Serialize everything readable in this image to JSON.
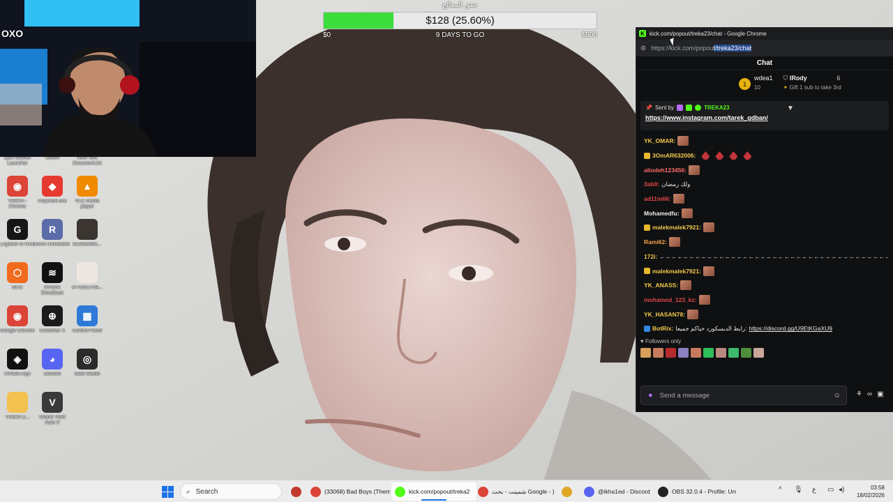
{
  "goal": {
    "title": "حقق المعالج",
    "amount_label": "$128 (25.60%)",
    "progress": 0.256,
    "min_label": "$0",
    "max_label": "$500",
    "days_label": "9 DAYS TO GO",
    "fill_color": "#3ddc3d"
  },
  "webcam": {
    "overlay_text": "OXO"
  },
  "desktop_icons": [
    {
      "label": "Epic Games Launcher",
      "icon": "epic-games-icon",
      "color": "#2b2b2b",
      "glyph": "E"
    },
    {
      "label": "Steam",
      "icon": "steam-icon",
      "color": "#1b2838",
      "glyph": "S"
    },
    {
      "label": "New Text Document.txt",
      "icon": "text-document-icon",
      "color": "#f2f2f2",
      "glyph": ""
    },
    {
      "label": "TREKA - Chrome",
      "icon": "chrome-icon",
      "color": "#db4437",
      "glyph": "◉"
    },
    {
      "label": "AnyDesk.exe",
      "icon": "anydesk-icon",
      "color": "#e63a31",
      "glyph": "◆"
    },
    {
      "label": "VLC media player",
      "icon": "vlc-icon",
      "color": "#f08a00",
      "glyph": "▲"
    },
    {
      "label": "Logitech G HUB",
      "icon": "logitech-ghub-icon",
      "color": "#161616",
      "glyph": "G"
    },
    {
      "label": "Revo Uninstaller",
      "icon": "revo-uninstaller-icon",
      "color": "#5b6ca8",
      "glyph": "R"
    },
    {
      "label": "b14f2eff6fe...",
      "icon": "image-file-icon",
      "color": "#3a3530",
      "glyph": ""
    },
    {
      "label": "GCC",
      "icon": "gcc-icon",
      "color": "#f06b1d",
      "glyph": "⬡"
    },
    {
      "label": "NVIDIA Broadcast",
      "icon": "nvidia-broadcast-icon",
      "color": "#111",
      "glyph": "≋"
    },
    {
      "label": "477a3c17d4...",
      "icon": "image-file-icon",
      "color": "#ede6e0",
      "glyph": ""
    },
    {
      "label": "Google Chrome",
      "icon": "chrome-icon",
      "color": "#db4437",
      "glyph": "◉"
    },
    {
      "label": "Crosshair X",
      "icon": "crosshair-icon",
      "color": "#1b1b1b",
      "glyph": "⊕"
    },
    {
      "label": "Control Panel",
      "icon": "control-panel-icon",
      "color": "#2f7ad6",
      "glyph": "▦"
    },
    {
      "label": "NVIDIA App",
      "icon": "nvidia-app-icon",
      "color": "#111",
      "glyph": "◈"
    },
    {
      "label": "Discord",
      "icon": "discord-icon",
      "color": "#5865f2",
      "glyph": "◕"
    },
    {
      "label": "OBS Studio",
      "icon": "obs-icon",
      "color": "#2b2b2b",
      "glyph": "◎"
    },
    {
      "label": "TREKA Z...",
      "icon": "folder-icon",
      "color": "#f2c14e",
      "glyph": ""
    },
    {
      "label": "Grand Theft Auto V",
      "icon": "gta-icon",
      "color": "#3a3a3a",
      "glyph": "V"
    }
  ],
  "chrome": {
    "title": "kick.com/popout/treka23/chat - Google Chrome",
    "url_prefix": "https://kick.com/popou",
    "url_selected": "t/treka23/chat"
  },
  "chat": {
    "header": "Chat",
    "leaderboard": {
      "rank": "1",
      "first_name": "wdea1",
      "first_count": "10",
      "second_name": "IRody",
      "second_count": "6",
      "gift_text": "Gift 1 sub to take 3rd"
    },
    "pinned": {
      "sent_by_label": "Sent by",
      "sender": "TREKA23",
      "link": "https://www.instagram.com/tarek_gdban/"
    },
    "messages": [
      {
        "user": "YK_OMAR:",
        "color": "#f2c94c",
        "text": "",
        "emotes": 1,
        "badge": ""
      },
      {
        "user": "3OmAR632006:",
        "color": "#f2c94c",
        "text": "",
        "emotes": 0,
        "small_emotes": 4,
        "badge": "#e8b62c"
      },
      {
        "user": "aliodeh123456:",
        "color": "#ff6b6b",
        "text": "",
        "emotes": 1,
        "badge": ""
      },
      {
        "user": "3ab0:",
        "color": "#e04848",
        "text": "ولك رمضان",
        "emotes": 0,
        "badge": ""
      },
      {
        "user": "ad11m66:",
        "color": "#e04848",
        "text": "",
        "emotes": 1,
        "badge": ""
      },
      {
        "user": "Mohamedfu:",
        "color": "#f0f0f0",
        "text": "",
        "emotes": 1,
        "badge": ""
      },
      {
        "user": "malekmalek7921:",
        "color": "#f2c94c",
        "text": "",
        "emotes": 1,
        "badge": "#e8b62c"
      },
      {
        "user": "Rami62:",
        "color": "#f2a24c",
        "text": "",
        "emotes": 1,
        "badge": ""
      },
      {
        "user": "172i:",
        "color": "#f2c94c",
        "text": "←←←←←←←←←←←←←←←←←←←←←←←←←←←←←←←←←←←←←←←←←←←←←←←←←←←←←←←←←←←←←←←←←←←←←←←←←←←←",
        "emotes": 0,
        "badge": ""
      },
      {
        "user": "malekmalek7921:",
        "color": "#f2c94c",
        "text": "",
        "emotes": 1,
        "badge": "#e8b62c"
      },
      {
        "user": "YK_ANASS:",
        "color": "#f2c94c",
        "text": "",
        "emotes": 1,
        "badge": ""
      },
      {
        "user": "mohamed_123_kz:",
        "color": "#e04848",
        "text": "",
        "emotes": 1,
        "badge": ""
      },
      {
        "user": "YK_HASAN78:",
        "color": "#f2c94c",
        "text": "",
        "emotes": 1,
        "badge": ""
      },
      {
        "user": "BotRix:",
        "color": "#f2c94c",
        "text": "رابط الديسكورد حياكم جميعا:",
        "link": "https://discord.gg/U9EtKGaXU9",
        "emotes": 0,
        "badge": "#2f8ae0"
      }
    ],
    "followers_only": "Followers only",
    "input_placeholder": "Send a message"
  },
  "taskbar": {
    "search_label": "Search",
    "apps": [
      {
        "label": "",
        "icon": "file-manager-icon",
        "color": "#c0392b"
      },
      {
        "label": "(33068) Bad Boys (Them",
        "icon": "chrome-icon",
        "color": "#db4437"
      },
      {
        "label": "kick.com/popout/treka2",
        "icon": "kick-icon",
        "color": "#53fc18"
      },
      {
        "label": "شمينت - بحث Google - )",
        "icon": "chrome-icon",
        "color": "#db4437"
      },
      {
        "label": "",
        "icon": "folder-icon",
        "color": "#e0a624"
      },
      {
        "label": "@ikha1ed - Discord",
        "icon": "discord-icon",
        "color": "#5865f2"
      },
      {
        "label": "OBS 32.0.4 - Profile: Unt",
        "icon": "obs-icon",
        "color": "#222"
      }
    ],
    "time": "03:58",
    "date": "18/02/2026",
    "lang": "ع"
  },
  "colors": {
    "kick_green": "#53fc18",
    "chat_bg": "#0f1011"
  }
}
